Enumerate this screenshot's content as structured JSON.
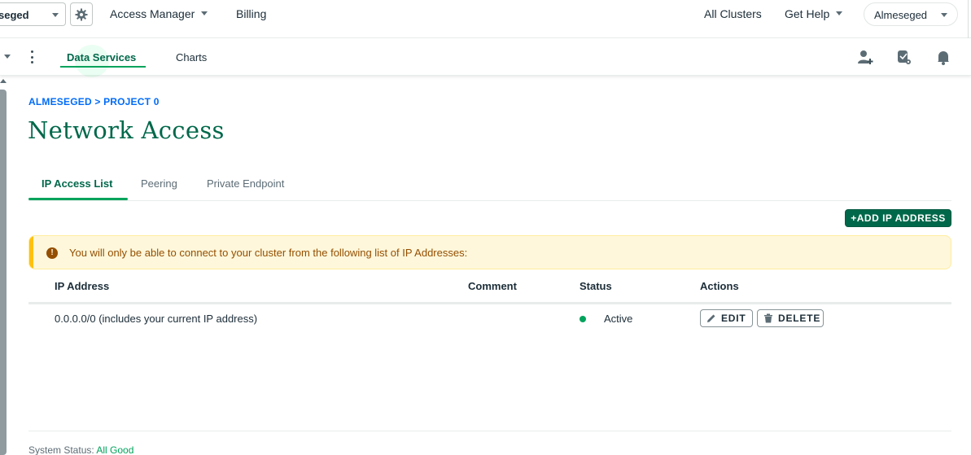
{
  "topnav": {
    "org_name": "seged",
    "access_manager": "Access Manager",
    "billing": "Billing",
    "all_clusters": "All Clusters",
    "get_help": "Get Help",
    "user_name": "Almeseged"
  },
  "subnav": {
    "tabs": [
      "Data Services",
      "Charts"
    ],
    "active_tab": "Data Services"
  },
  "breadcrumb": "ALMESEGED > PROJECT 0",
  "page_title": "Network Access",
  "tabs": [
    "IP Access List",
    "Peering",
    "Private Endpoint"
  ],
  "add_button": "+ADD IP ADDRESS",
  "banner_text": "You will only be able to connect to your cluster from the following list of IP Addresses:",
  "table": {
    "headers": [
      "IP Address",
      "Comment",
      "Status",
      "Actions"
    ],
    "rows": [
      {
        "ip": "0.0.0.0/0 (includes your current IP address)",
        "comment": "",
        "status": "Active",
        "actions": [
          "EDIT",
          "DELETE"
        ]
      }
    ]
  },
  "footer": {
    "label": "System Status: ",
    "value": "All Good"
  },
  "colors": {
    "brand_green": "#00684a",
    "accent_green": "#00a35c",
    "link_blue": "#016bf8",
    "warning_bg": "#fef7db",
    "warning_text": "#944f01"
  }
}
